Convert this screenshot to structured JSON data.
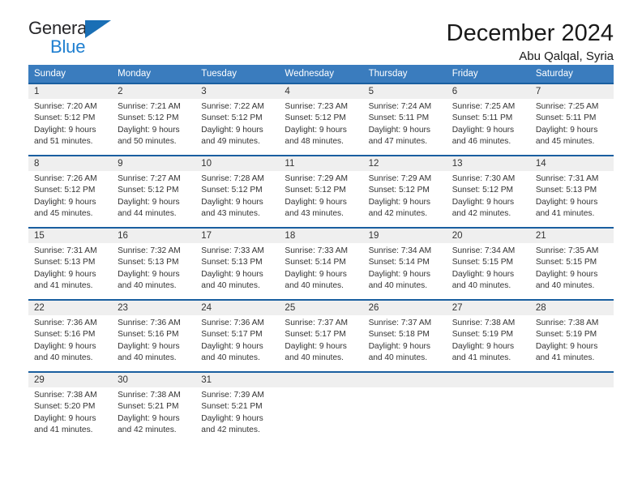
{
  "brand": {
    "name_top": "General",
    "name_bottom": "Blue",
    "accent_color": "#1a6fb5",
    "text_color": "#27272a"
  },
  "header": {
    "title": "December 2024",
    "subtitle": "Abu Qalqal, Syria"
  },
  "calendar": {
    "header_bg": "#3a7cbe",
    "separator_color": "#1a5fa0",
    "daynum_bg": "#efefef",
    "weekdays": [
      "Sunday",
      "Monday",
      "Tuesday",
      "Wednesday",
      "Thursday",
      "Friday",
      "Saturday"
    ],
    "weeks": [
      [
        {
          "day": "1",
          "sunrise": "Sunrise: 7:20 AM",
          "sunset": "Sunset: 5:12 PM",
          "daylight": "Daylight: 9 hours and 51 minutes."
        },
        {
          "day": "2",
          "sunrise": "Sunrise: 7:21 AM",
          "sunset": "Sunset: 5:12 PM",
          "daylight": "Daylight: 9 hours and 50 minutes."
        },
        {
          "day": "3",
          "sunrise": "Sunrise: 7:22 AM",
          "sunset": "Sunset: 5:12 PM",
          "daylight": "Daylight: 9 hours and 49 minutes."
        },
        {
          "day": "4",
          "sunrise": "Sunrise: 7:23 AM",
          "sunset": "Sunset: 5:12 PM",
          "daylight": "Daylight: 9 hours and 48 minutes."
        },
        {
          "day": "5",
          "sunrise": "Sunrise: 7:24 AM",
          "sunset": "Sunset: 5:11 PM",
          "daylight": "Daylight: 9 hours and 47 minutes."
        },
        {
          "day": "6",
          "sunrise": "Sunrise: 7:25 AM",
          "sunset": "Sunset: 5:11 PM",
          "daylight": "Daylight: 9 hours and 46 minutes."
        },
        {
          "day": "7",
          "sunrise": "Sunrise: 7:25 AM",
          "sunset": "Sunset: 5:11 PM",
          "daylight": "Daylight: 9 hours and 45 minutes."
        }
      ],
      [
        {
          "day": "8",
          "sunrise": "Sunrise: 7:26 AM",
          "sunset": "Sunset: 5:12 PM",
          "daylight": "Daylight: 9 hours and 45 minutes."
        },
        {
          "day": "9",
          "sunrise": "Sunrise: 7:27 AM",
          "sunset": "Sunset: 5:12 PM",
          "daylight": "Daylight: 9 hours and 44 minutes."
        },
        {
          "day": "10",
          "sunrise": "Sunrise: 7:28 AM",
          "sunset": "Sunset: 5:12 PM",
          "daylight": "Daylight: 9 hours and 43 minutes."
        },
        {
          "day": "11",
          "sunrise": "Sunrise: 7:29 AM",
          "sunset": "Sunset: 5:12 PM",
          "daylight": "Daylight: 9 hours and 43 minutes."
        },
        {
          "day": "12",
          "sunrise": "Sunrise: 7:29 AM",
          "sunset": "Sunset: 5:12 PM",
          "daylight": "Daylight: 9 hours and 42 minutes."
        },
        {
          "day": "13",
          "sunrise": "Sunrise: 7:30 AM",
          "sunset": "Sunset: 5:12 PM",
          "daylight": "Daylight: 9 hours and 42 minutes."
        },
        {
          "day": "14",
          "sunrise": "Sunrise: 7:31 AM",
          "sunset": "Sunset: 5:13 PM",
          "daylight": "Daylight: 9 hours and 41 minutes."
        }
      ],
      [
        {
          "day": "15",
          "sunrise": "Sunrise: 7:31 AM",
          "sunset": "Sunset: 5:13 PM",
          "daylight": "Daylight: 9 hours and 41 minutes."
        },
        {
          "day": "16",
          "sunrise": "Sunrise: 7:32 AM",
          "sunset": "Sunset: 5:13 PM",
          "daylight": "Daylight: 9 hours and 40 minutes."
        },
        {
          "day": "17",
          "sunrise": "Sunrise: 7:33 AM",
          "sunset": "Sunset: 5:13 PM",
          "daylight": "Daylight: 9 hours and 40 minutes."
        },
        {
          "day": "18",
          "sunrise": "Sunrise: 7:33 AM",
          "sunset": "Sunset: 5:14 PM",
          "daylight": "Daylight: 9 hours and 40 minutes."
        },
        {
          "day": "19",
          "sunrise": "Sunrise: 7:34 AM",
          "sunset": "Sunset: 5:14 PM",
          "daylight": "Daylight: 9 hours and 40 minutes."
        },
        {
          "day": "20",
          "sunrise": "Sunrise: 7:34 AM",
          "sunset": "Sunset: 5:15 PM",
          "daylight": "Daylight: 9 hours and 40 minutes."
        },
        {
          "day": "21",
          "sunrise": "Sunrise: 7:35 AM",
          "sunset": "Sunset: 5:15 PM",
          "daylight": "Daylight: 9 hours and 40 minutes."
        }
      ],
      [
        {
          "day": "22",
          "sunrise": "Sunrise: 7:36 AM",
          "sunset": "Sunset: 5:16 PM",
          "daylight": "Daylight: 9 hours and 40 minutes."
        },
        {
          "day": "23",
          "sunrise": "Sunrise: 7:36 AM",
          "sunset": "Sunset: 5:16 PM",
          "daylight": "Daylight: 9 hours and 40 minutes."
        },
        {
          "day": "24",
          "sunrise": "Sunrise: 7:36 AM",
          "sunset": "Sunset: 5:17 PM",
          "daylight": "Daylight: 9 hours and 40 minutes."
        },
        {
          "day": "25",
          "sunrise": "Sunrise: 7:37 AM",
          "sunset": "Sunset: 5:17 PM",
          "daylight": "Daylight: 9 hours and 40 minutes."
        },
        {
          "day": "26",
          "sunrise": "Sunrise: 7:37 AM",
          "sunset": "Sunset: 5:18 PM",
          "daylight": "Daylight: 9 hours and 40 minutes."
        },
        {
          "day": "27",
          "sunrise": "Sunrise: 7:38 AM",
          "sunset": "Sunset: 5:19 PM",
          "daylight": "Daylight: 9 hours and 41 minutes."
        },
        {
          "day": "28",
          "sunrise": "Sunrise: 7:38 AM",
          "sunset": "Sunset: 5:19 PM",
          "daylight": "Daylight: 9 hours and 41 minutes."
        }
      ],
      [
        {
          "day": "29",
          "sunrise": "Sunrise: 7:38 AM",
          "sunset": "Sunset: 5:20 PM",
          "daylight": "Daylight: 9 hours and 41 minutes."
        },
        {
          "day": "30",
          "sunrise": "Sunrise: 7:38 AM",
          "sunset": "Sunset: 5:21 PM",
          "daylight": "Daylight: 9 hours and 42 minutes."
        },
        {
          "day": "31",
          "sunrise": "Sunrise: 7:39 AM",
          "sunset": "Sunset: 5:21 PM",
          "daylight": "Daylight: 9 hours and 42 minutes."
        },
        {
          "day": "",
          "sunrise": "",
          "sunset": "",
          "daylight": ""
        },
        {
          "day": "",
          "sunrise": "",
          "sunset": "",
          "daylight": ""
        },
        {
          "day": "",
          "sunrise": "",
          "sunset": "",
          "daylight": ""
        },
        {
          "day": "",
          "sunrise": "",
          "sunset": "",
          "daylight": ""
        }
      ]
    ]
  }
}
